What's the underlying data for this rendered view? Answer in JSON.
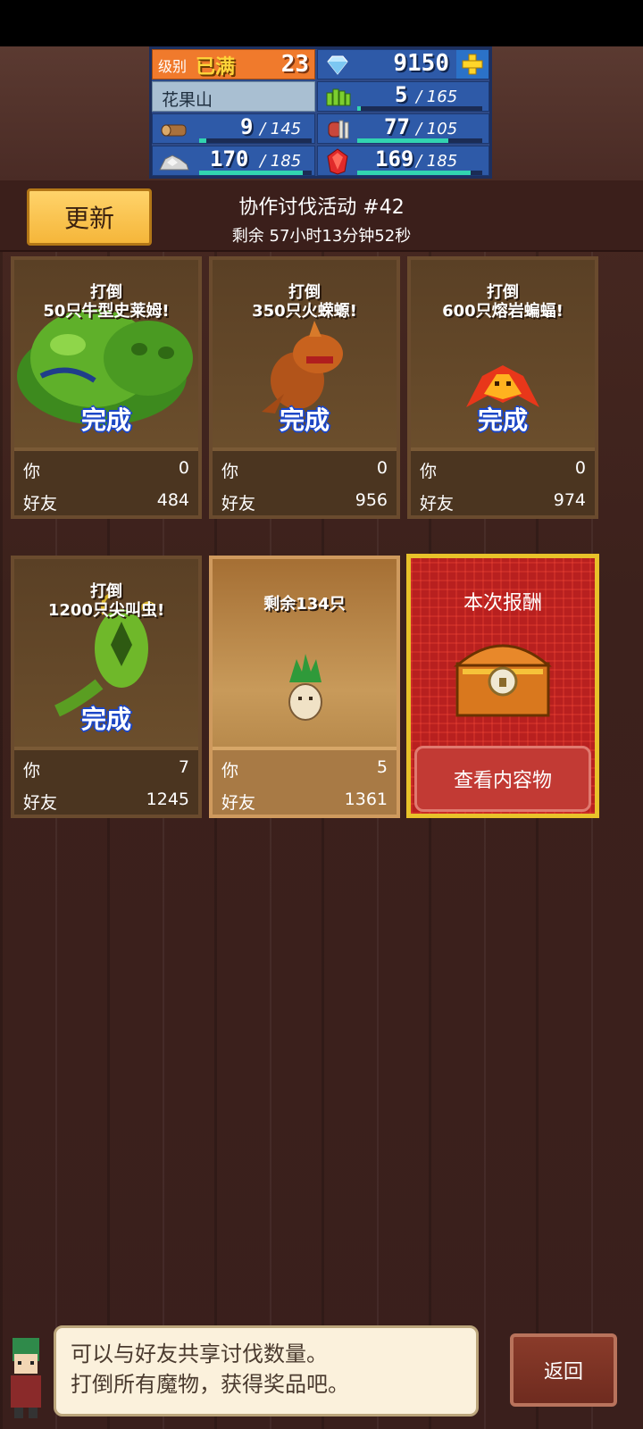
{
  "resources": {
    "level_label": "级别",
    "level_status": "已满",
    "level_value": "23",
    "gems": "9150",
    "gems_add_icon": "plus-icon",
    "location": "花果山",
    "grass": {
      "value": "5",
      "max": "165",
      "fill": 0.03
    },
    "wood": {
      "value": "9",
      "max": "145",
      "fill": 0.06
    },
    "meat": {
      "value": "77",
      "max": "105",
      "fill": 0.73
    },
    "ore": {
      "value": "170",
      "max": "185",
      "fill": 0.92
    },
    "ruby": {
      "value": "169",
      "max": "185",
      "fill": 0.91
    }
  },
  "header": {
    "refresh_label": "更新",
    "event_title": "协作讨伐活动 #42",
    "event_timer": "剩余 57小时13分钟52秒"
  },
  "labels": {
    "you": "你",
    "friends": "好友",
    "done": "完成"
  },
  "cards": [
    {
      "title_line1": "打倒",
      "title_line2": "50只牛型史莱姆!",
      "you": "0",
      "friends": "484",
      "status": "完成"
    },
    {
      "title_line1": "打倒",
      "title_line2": "350只火蝾螈!",
      "you": "0",
      "friends": "956",
      "status": "完成"
    },
    {
      "title_line1": "打倒",
      "title_line2": "600只熔岩蝙蝠!",
      "you": "0",
      "friends": "974",
      "status": "完成"
    },
    {
      "title_line1": "打倒",
      "title_line2": "1200只尖叫虫!",
      "you": "7",
      "friends": "1245",
      "status": "完成"
    },
    {
      "title_line1": "剩余134只",
      "title_line2": "",
      "you": "5",
      "friends": "1361",
      "status": ""
    }
  ],
  "reward": {
    "title": "本次报酬",
    "view_label": "查看内容物"
  },
  "dialog": {
    "line1": "可以与好友共享讨伐数量。",
    "line2": "打倒所有魔物，获得奖品吧。"
  },
  "back_label": "返回",
  "colors": {
    "accent_gold": "#f5b63a",
    "done_blue": "#1b46c7",
    "reward_red": "#b8201f",
    "panel_blue": "#2e5aa8"
  }
}
